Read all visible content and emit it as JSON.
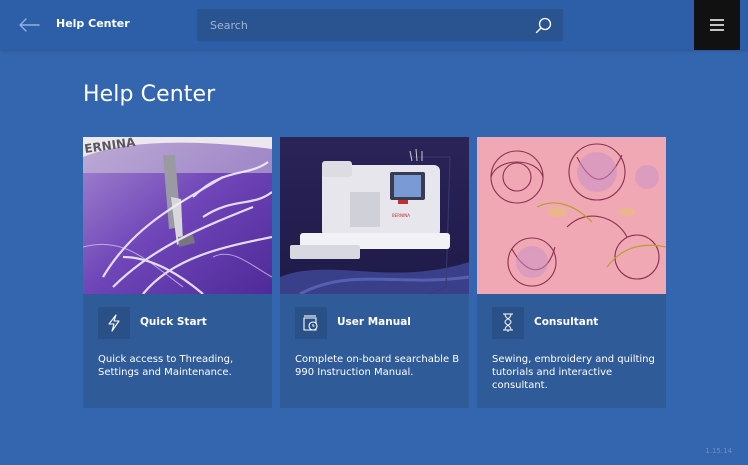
{
  "header": {
    "title": "Help Center",
    "search_placeholder": "Search"
  },
  "page": {
    "heading": "Help Center"
  },
  "cards": [
    {
      "title": "Quick Start",
      "description": "Quick access to Threading, Settings and Maintenance.",
      "icon": "lightning-icon",
      "image_text": "ERNINA"
    },
    {
      "title": "User Manual",
      "description": "Complete on-board searchable B 990 Instruction Manual.",
      "icon": "manual-clock-icon",
      "image_text": "BERNINA"
    },
    {
      "title": "Consultant",
      "description": "Sewing, embroidery and quilting tutorials and interactive consultant.",
      "icon": "spool-icon"
    }
  ],
  "footer": {
    "version": "1.15.14"
  },
  "colors": {
    "background": "#3466b0",
    "header": "#2d5ea8",
    "card": "#2f5b98",
    "menu_button": "#111111"
  }
}
